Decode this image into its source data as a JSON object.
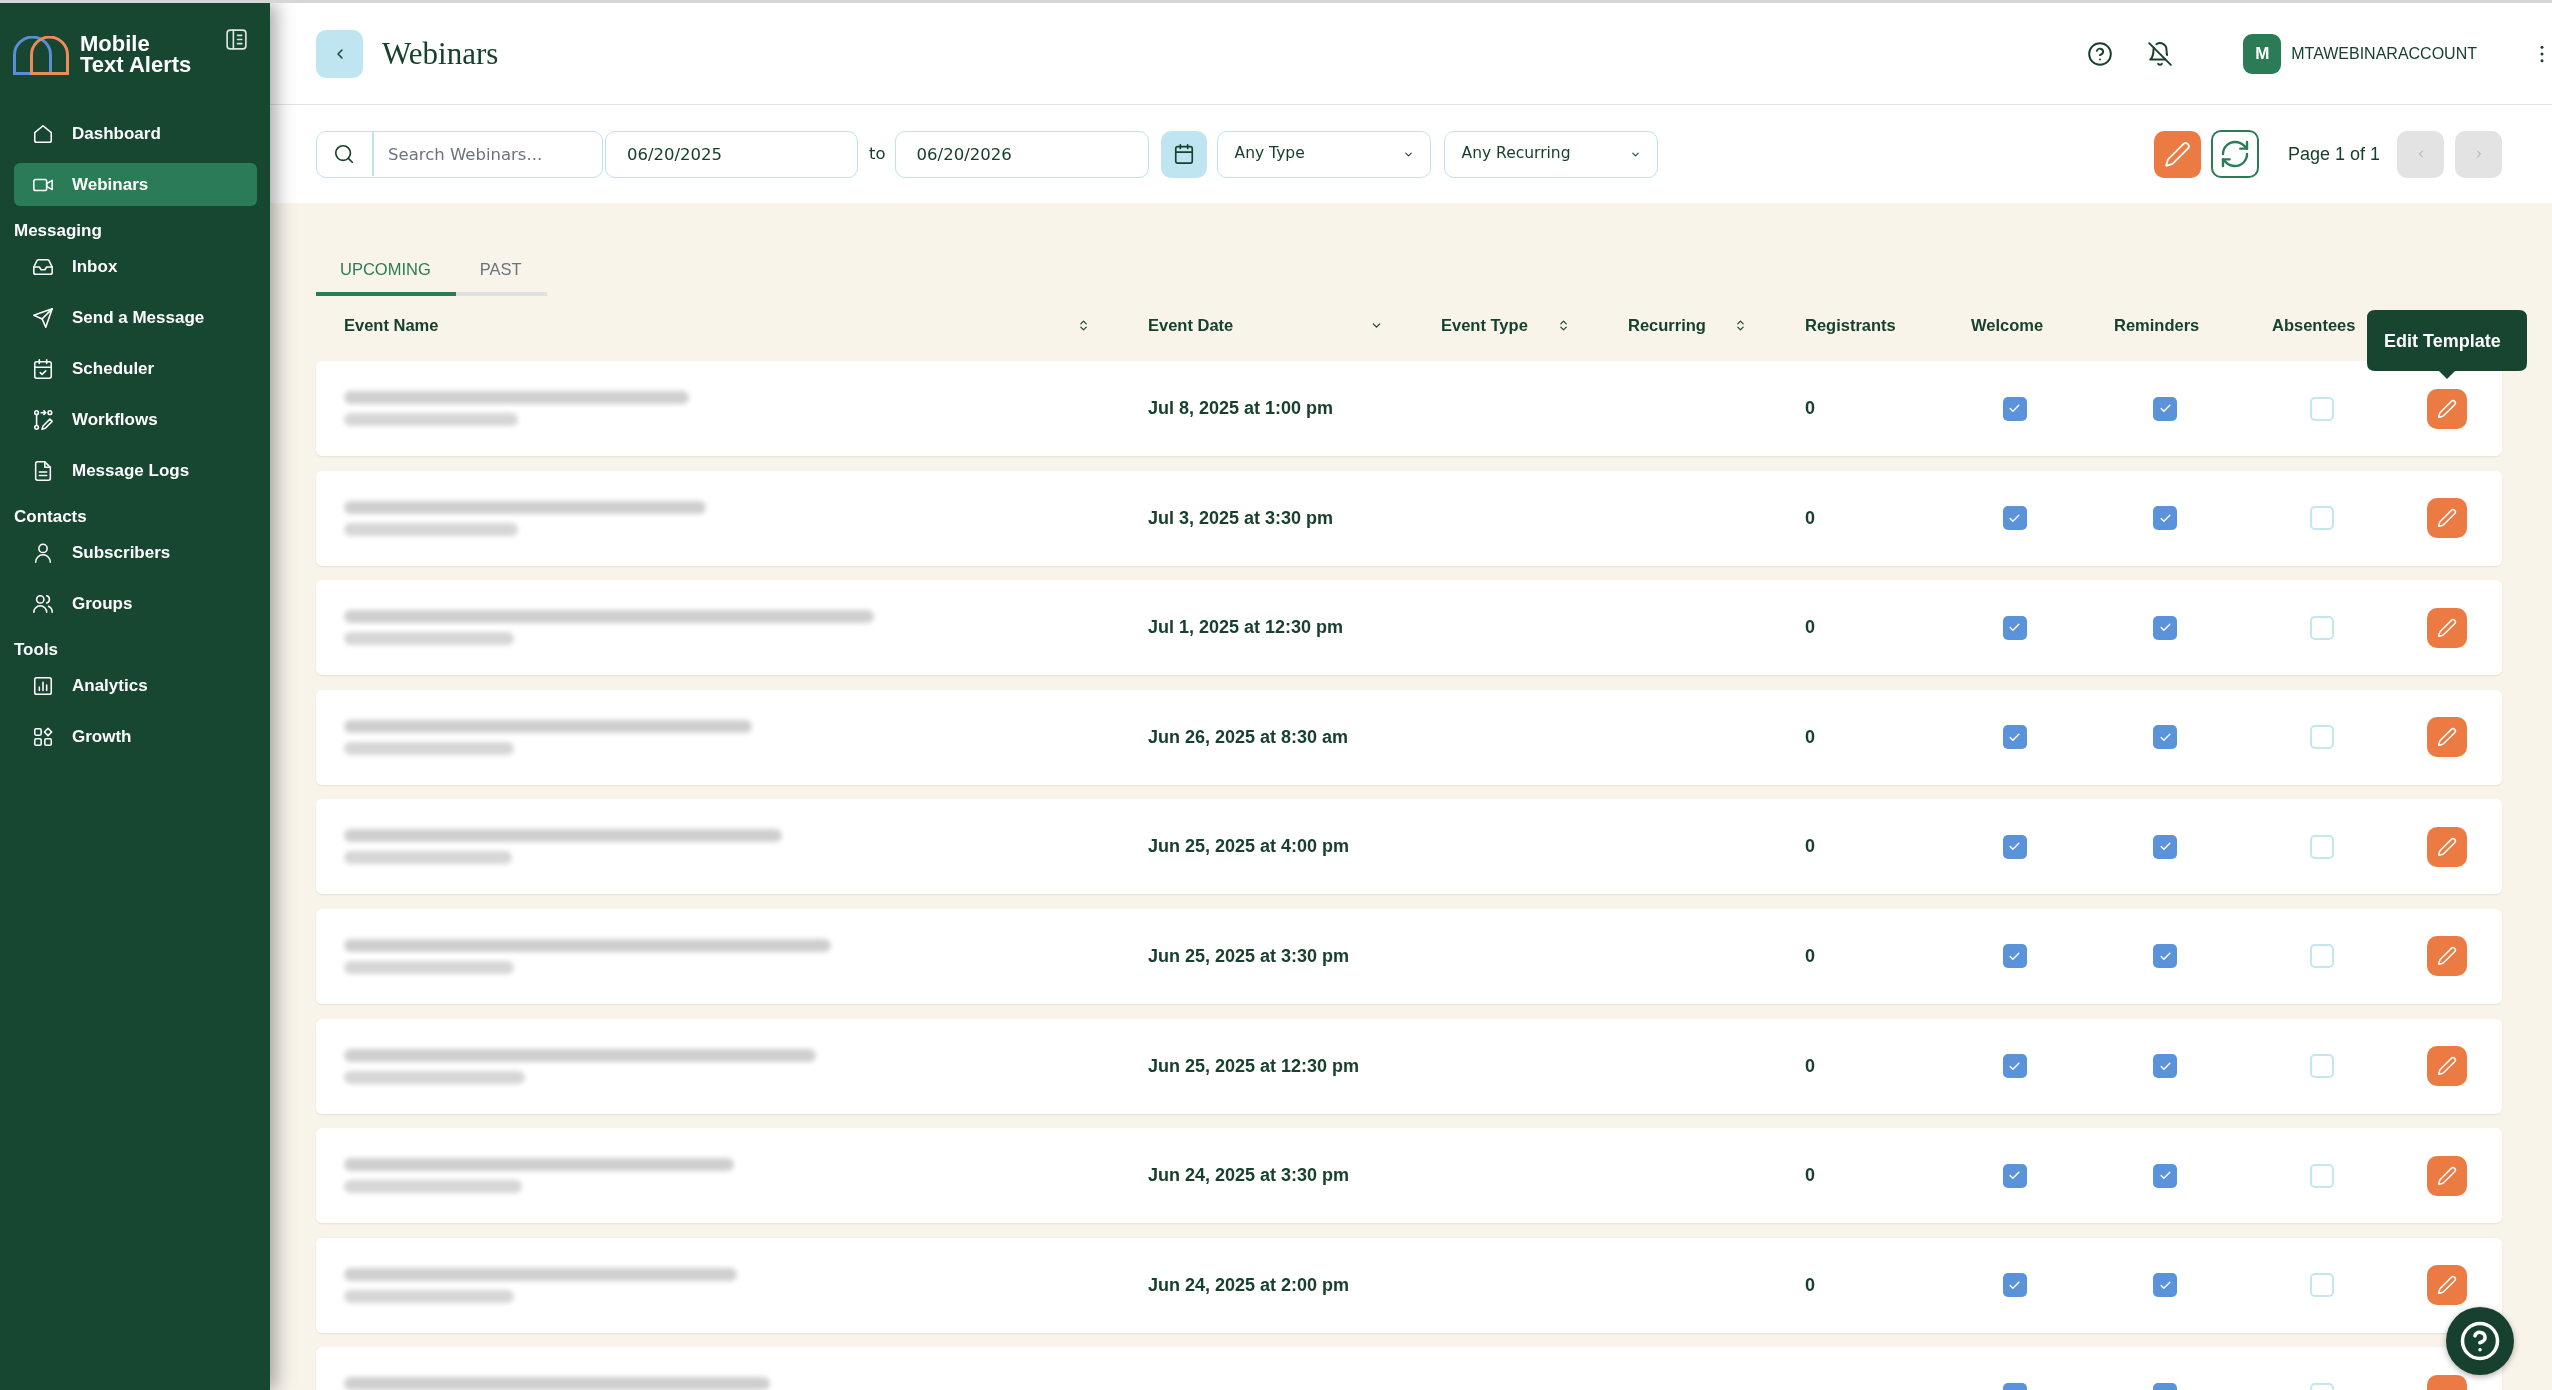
{
  "sidebar": {
    "brand": {
      "lines": [
        "Mobile",
        "Text Alerts"
      ]
    },
    "sections": [
      {
        "items": [
          {
            "label": "Dashboard",
            "selected": false
          },
          {
            "label": "Webinars",
            "selected": true
          }
        ]
      },
      {
        "label": "Messaging",
        "items": [
          {
            "label": "Inbox",
            "selected": false
          },
          {
            "label": "Send a Message",
            "selected": false
          },
          {
            "label": "Scheduler",
            "selected": false
          },
          {
            "label": "Workflows",
            "selected": false
          },
          {
            "label": "Message Logs",
            "selected": false
          }
        ]
      },
      {
        "label": "Contacts",
        "items": [
          {
            "label": "Subscribers",
            "selected": false
          },
          {
            "label": "Groups",
            "selected": false
          }
        ]
      },
      {
        "label": "Tools",
        "items": [
          {
            "label": "Analytics",
            "selected": false
          },
          {
            "label": "Growth",
            "selected": false
          }
        ]
      }
    ]
  },
  "header": {
    "title": "Webinars",
    "account": {
      "initial": "M",
      "name": "MTAWEBINARACCOUNT"
    }
  },
  "filters": {
    "search": {
      "placeholder": "Search Webinars..."
    },
    "date_from": {
      "value": "06/20/2025"
    },
    "range_separator": "to",
    "date_to": {
      "value": "06/20/2026"
    },
    "type_select": {
      "value": "Any Type"
    },
    "recurring_select": {
      "value": "Any Recurring"
    }
  },
  "pagination": {
    "label": "Page 1 of 1",
    "prev": {
      "disabled": true
    },
    "next": {
      "disabled": true
    }
  },
  "tabs": [
    {
      "label": "UPCOMING",
      "selected": true
    },
    {
      "label": "PAST",
      "selected": false
    }
  ],
  "table": {
    "columns": [
      {
        "label": "Event Name",
        "kind": "sortable"
      },
      {
        "label": "Event Date",
        "kind": "sorted_descending"
      },
      {
        "label": "Event Type",
        "kind": "sortable"
      },
      {
        "label": "Recurring",
        "kind": "sortable"
      },
      {
        "label": "Registrants",
        "kind": "plain"
      },
      {
        "label": "Welcome",
        "kind": "plain"
      },
      {
        "label": "Reminders",
        "kind": "plain"
      },
      {
        "label": "Absentees",
        "kind": "plain"
      }
    ],
    "rows": [
      {
        "date": "Jul 8, 2025 at 1:00 pm",
        "registrants": "0",
        "welcome": true,
        "reminders": true,
        "absentees": false,
        "tooltip": "Edit Template"
      },
      {
        "date": "Jul 3, 2025 at 3:30 pm",
        "registrants": "0",
        "welcome": true,
        "reminders": true,
        "absentees": false
      },
      {
        "date": "Jul 1, 2025 at 12:30 pm",
        "registrants": "0",
        "welcome": true,
        "reminders": true,
        "absentees": false
      },
      {
        "date": "Jun 26, 2025 at 8:30 am",
        "registrants": "0",
        "welcome": true,
        "reminders": true,
        "absentees": false
      },
      {
        "date": "Jun 25, 2025 at 4:00 pm",
        "registrants": "0",
        "welcome": true,
        "reminders": true,
        "absentees": false
      },
      {
        "date": "Jun 25, 2025 at 3:30 pm",
        "registrants": "0",
        "welcome": true,
        "reminders": true,
        "absentees": false
      },
      {
        "date": "Jun 25, 2025 at 12:30 pm",
        "registrants": "0",
        "welcome": true,
        "reminders": true,
        "absentees": false
      },
      {
        "date": "Jun 24, 2025 at 3:30 pm",
        "registrants": "0",
        "welcome": true,
        "reminders": true,
        "absentees": false
      },
      {
        "date": "Jun 24, 2025 at 2:00 pm",
        "registrants": "0",
        "welcome": true,
        "reminders": true,
        "absentees": false
      },
      {
        "welcome": true,
        "reminders": true,
        "absentees": false
      }
    ]
  }
}
